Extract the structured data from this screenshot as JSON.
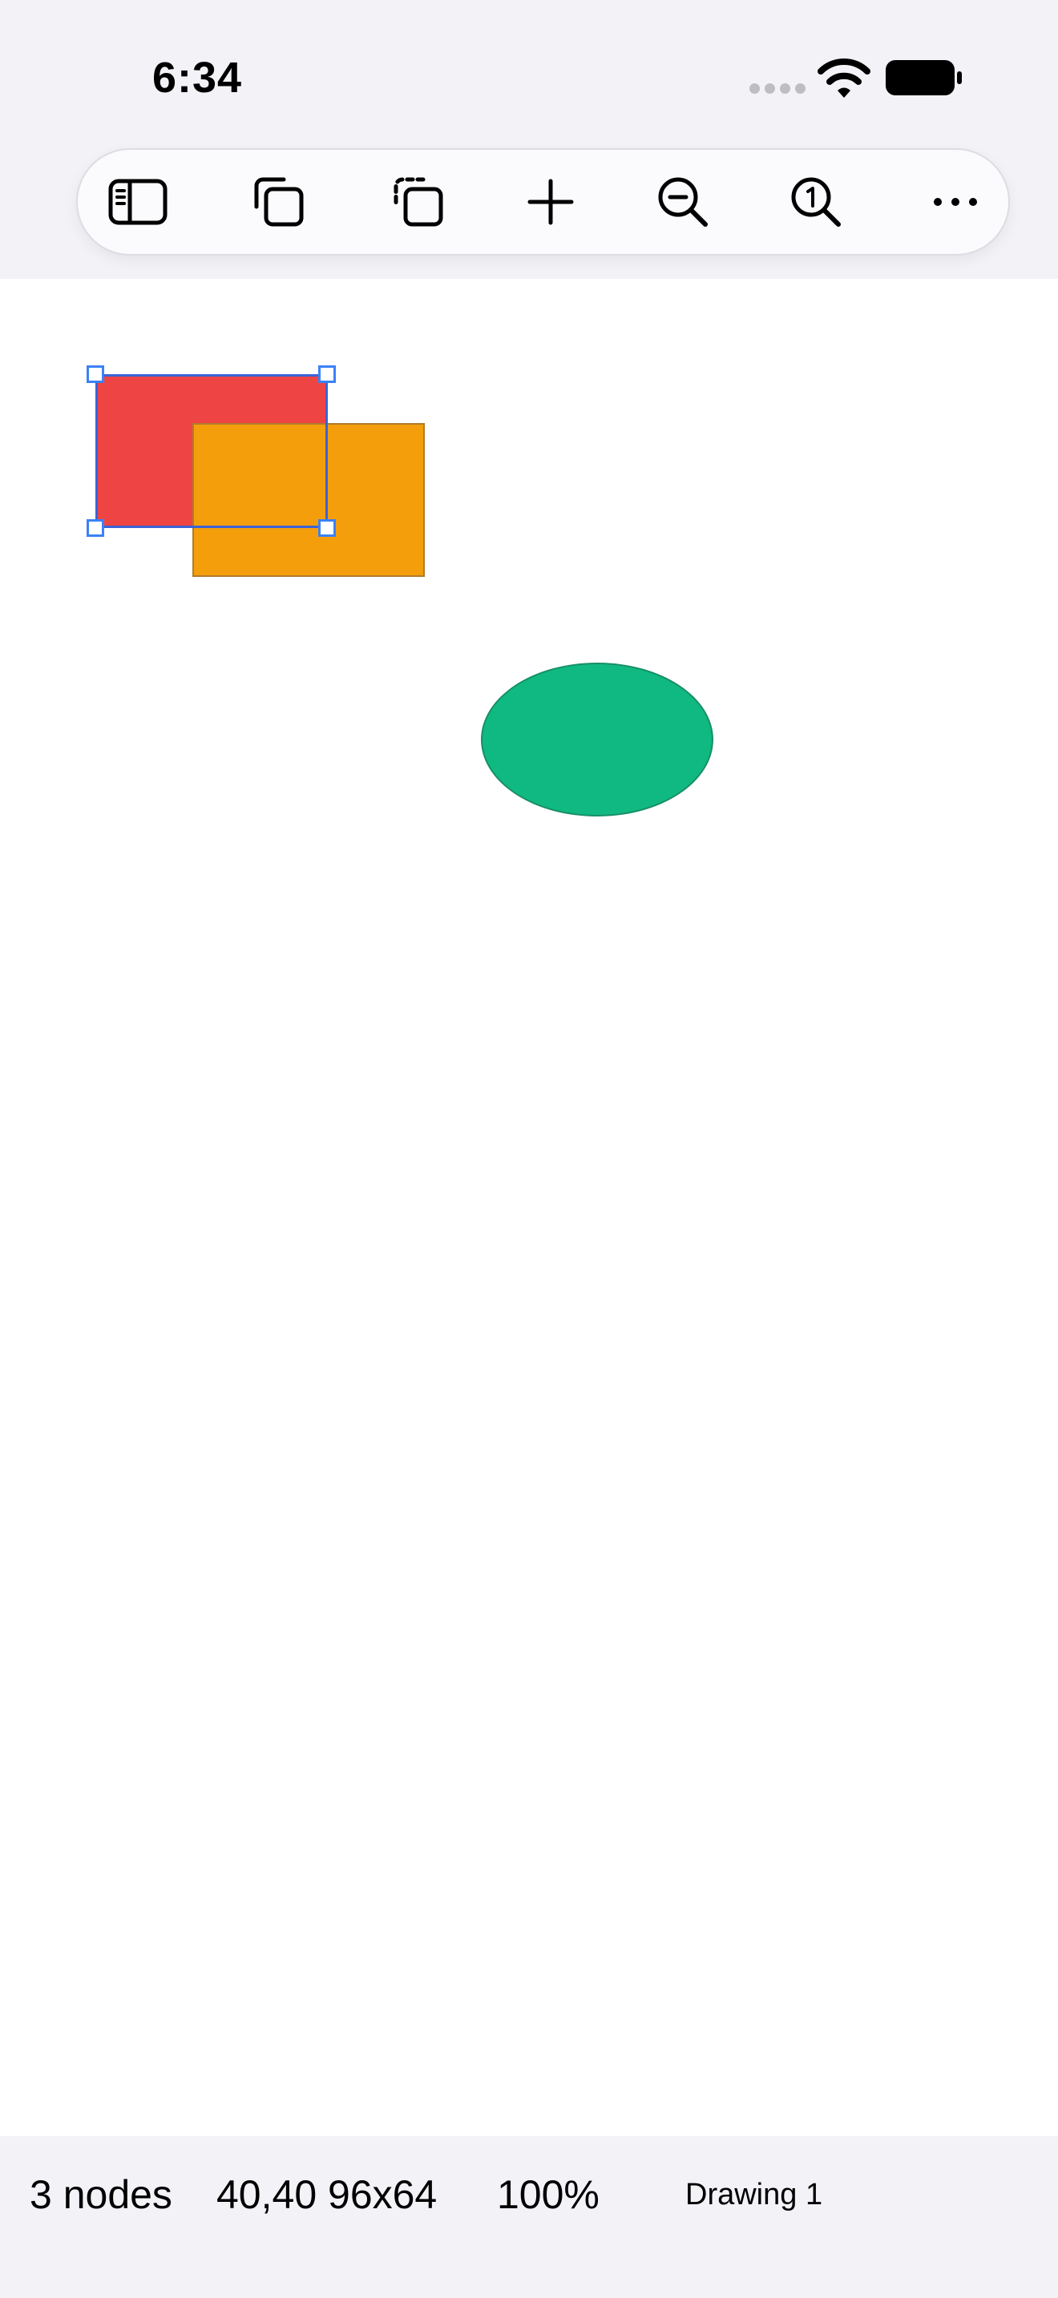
{
  "status_bar": {
    "time": "6:34"
  },
  "toolbar": {
    "buttons": [
      {
        "name": "sidebar-toggle-button",
        "icon": "sidebar-icon"
      },
      {
        "name": "duplicate-button",
        "icon": "duplicate-icon"
      },
      {
        "name": "paste-button",
        "icon": "paste-icon"
      },
      {
        "name": "add-button",
        "icon": "plus-icon"
      },
      {
        "name": "zoom-out-button",
        "icon": "zoom-out-icon"
      },
      {
        "name": "zoom-reset-button",
        "icon": "zoom-one-icon"
      },
      {
        "name": "more-button",
        "icon": "ellipsis-icon"
      }
    ]
  },
  "canvas": {
    "shapes": [
      {
        "kind": "rectangle",
        "fill": "#EF4444",
        "stroke": "#3B82F6",
        "selected": true
      },
      {
        "kind": "rectangle",
        "fill": "#F59E0B",
        "stroke": "#B07B2A",
        "selected": false
      },
      {
        "kind": "ellipse",
        "fill": "#10B981",
        "stroke": "#178F66",
        "selected": false
      }
    ],
    "selection_color": "#3B82F6"
  },
  "bottom_bar": {
    "node_count": "3 nodes",
    "selection_geometry": "40,40 96x64",
    "zoom": "100%",
    "document_name": "Drawing 1"
  },
  "colors": {
    "chrome_background": "#F2F2F7",
    "canvas_background": "#FFFFFF",
    "accent": "#3B82F6"
  }
}
